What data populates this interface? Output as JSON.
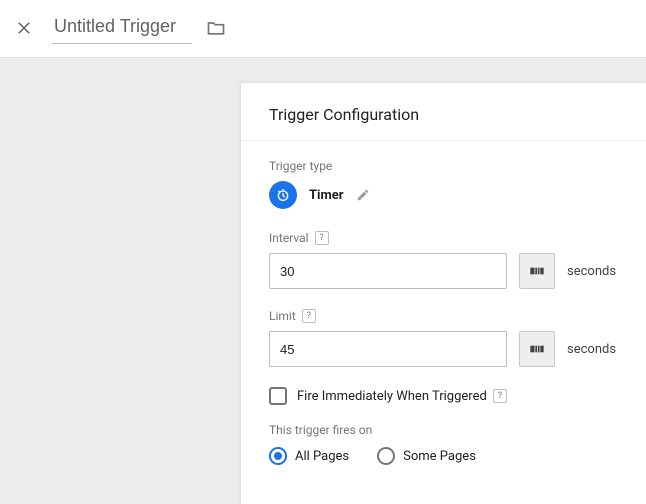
{
  "header": {
    "title": "Untitled Trigger"
  },
  "panel": {
    "title": "Trigger Configuration",
    "type_label": "Trigger type",
    "type_name": "Timer",
    "interval": {
      "label": "Interval",
      "value": "30",
      "unit": "seconds"
    },
    "limit": {
      "label": "Limit",
      "value": "45",
      "unit": "seconds"
    },
    "fire_immediately": {
      "label": "Fire Immediately When Triggered",
      "checked": false
    },
    "fires_on": {
      "label": "This trigger fires on",
      "options": [
        {
          "label": "All Pages",
          "selected": true
        },
        {
          "label": "Some Pages",
          "selected": false
        }
      ]
    },
    "help_glyph": "?"
  }
}
